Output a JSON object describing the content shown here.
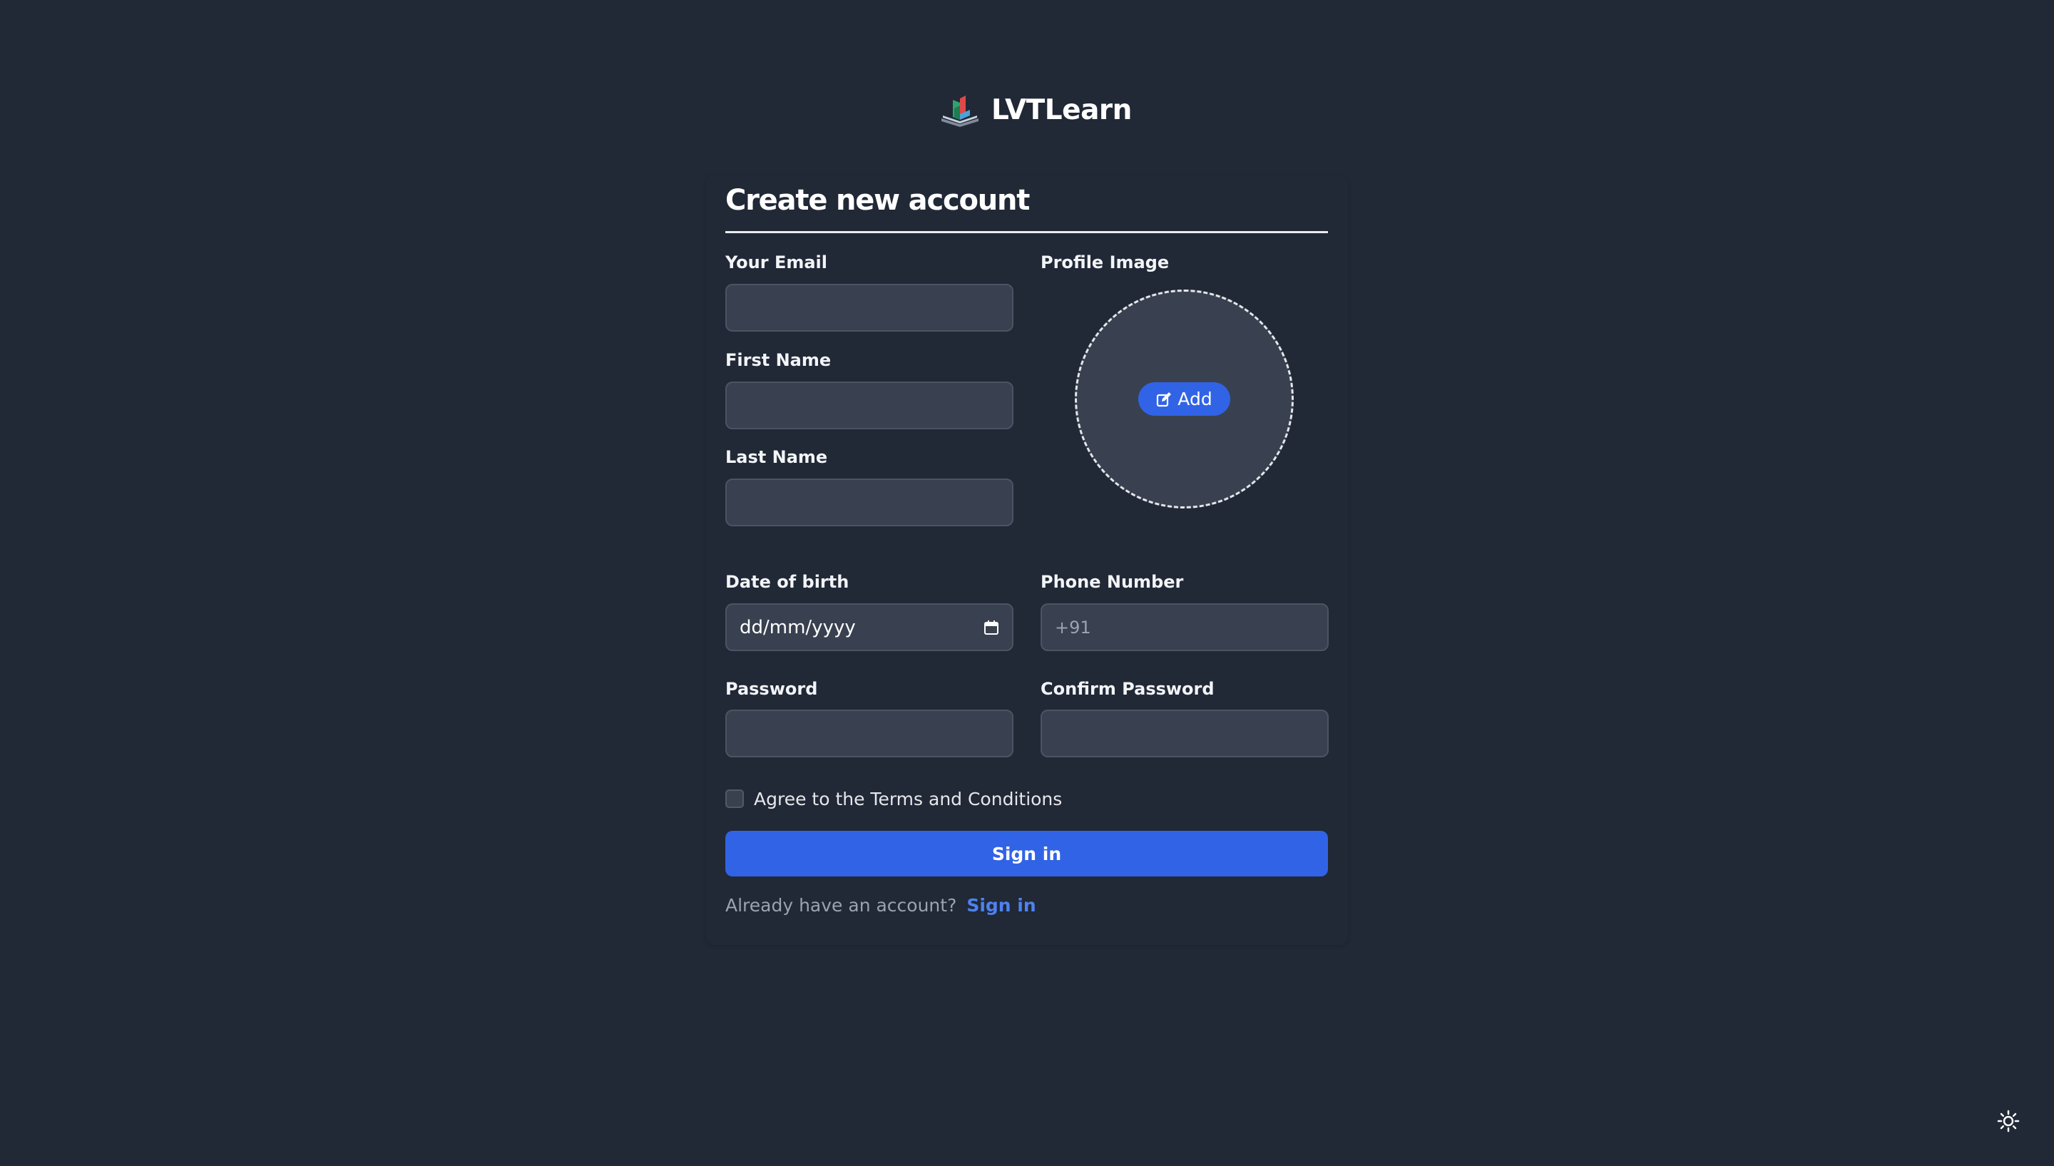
{
  "brand": {
    "name": "LVTLearn",
    "logo_icon": "open-book-logo-icon"
  },
  "form": {
    "title": "Create new account",
    "email": {
      "label": "Your Email",
      "value": "",
      "placeholder": ""
    },
    "first_name": {
      "label": "First Name",
      "value": "",
      "placeholder": ""
    },
    "last_name": {
      "label": "Last Name",
      "value": "",
      "placeholder": ""
    },
    "profile_image": {
      "label": "Profile Image",
      "add_label": "Add",
      "add_icon": "edit-icon"
    },
    "date_of_birth": {
      "label": "Date of birth",
      "placeholder": "dd/mm/yyyy",
      "icon": "calendar-icon"
    },
    "phone": {
      "label": "Phone Number",
      "placeholder": "+91",
      "value": ""
    },
    "password": {
      "label": "Password",
      "value": ""
    },
    "confirm_password": {
      "label": "Confirm Password",
      "value": ""
    },
    "terms": {
      "label": "Agree to the Terms and Conditions",
      "checked": false
    },
    "submit_label": "Sign in",
    "footer": {
      "text": "Already have an account?",
      "link_label": "Sign in"
    }
  },
  "theme_toggle": {
    "icon": "sun-icon"
  },
  "colors": {
    "background": "#212836",
    "input_background": "#394150",
    "accent": "#3163e6",
    "link": "#4d82f0"
  }
}
